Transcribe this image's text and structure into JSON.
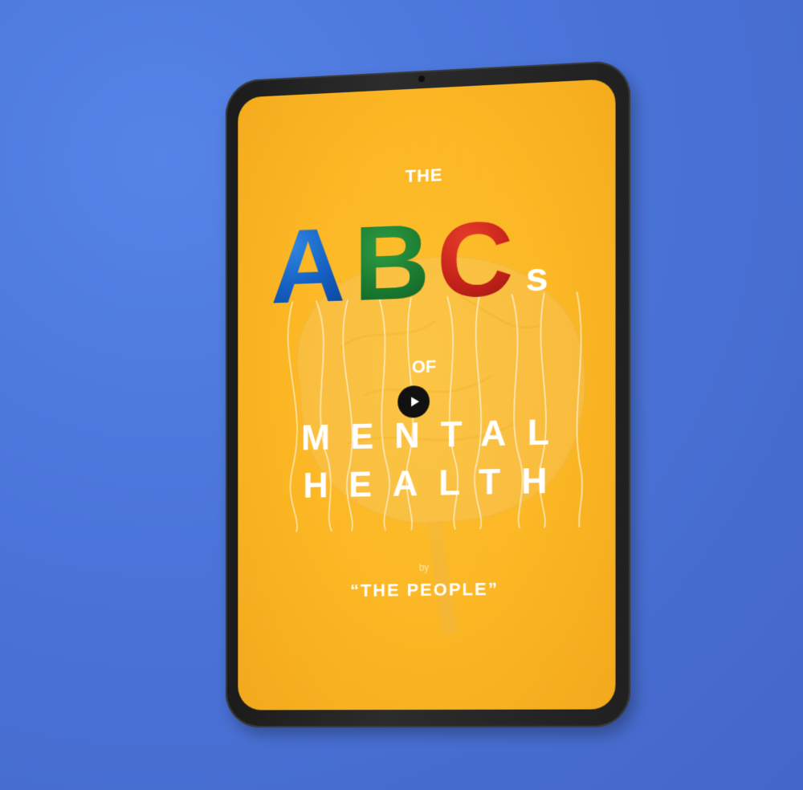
{
  "cover": {
    "the": "THE",
    "abc_a": "A",
    "abc_b": "B",
    "abc_c": "C",
    "abc_s": "s",
    "of": "OF",
    "mental": "MENTAL",
    "health": "HEALTH",
    "by": "by",
    "author": "“THE PEOPLE”"
  },
  "colors": {
    "background": "#4a74d9",
    "screen": "#fbb624",
    "letter_a": "#1560c2",
    "letter_b": "#1a7a30",
    "letter_c": "#c5221a",
    "bezel": "#1f1f1f"
  },
  "controls": {
    "play_icon": "play-icon"
  }
}
